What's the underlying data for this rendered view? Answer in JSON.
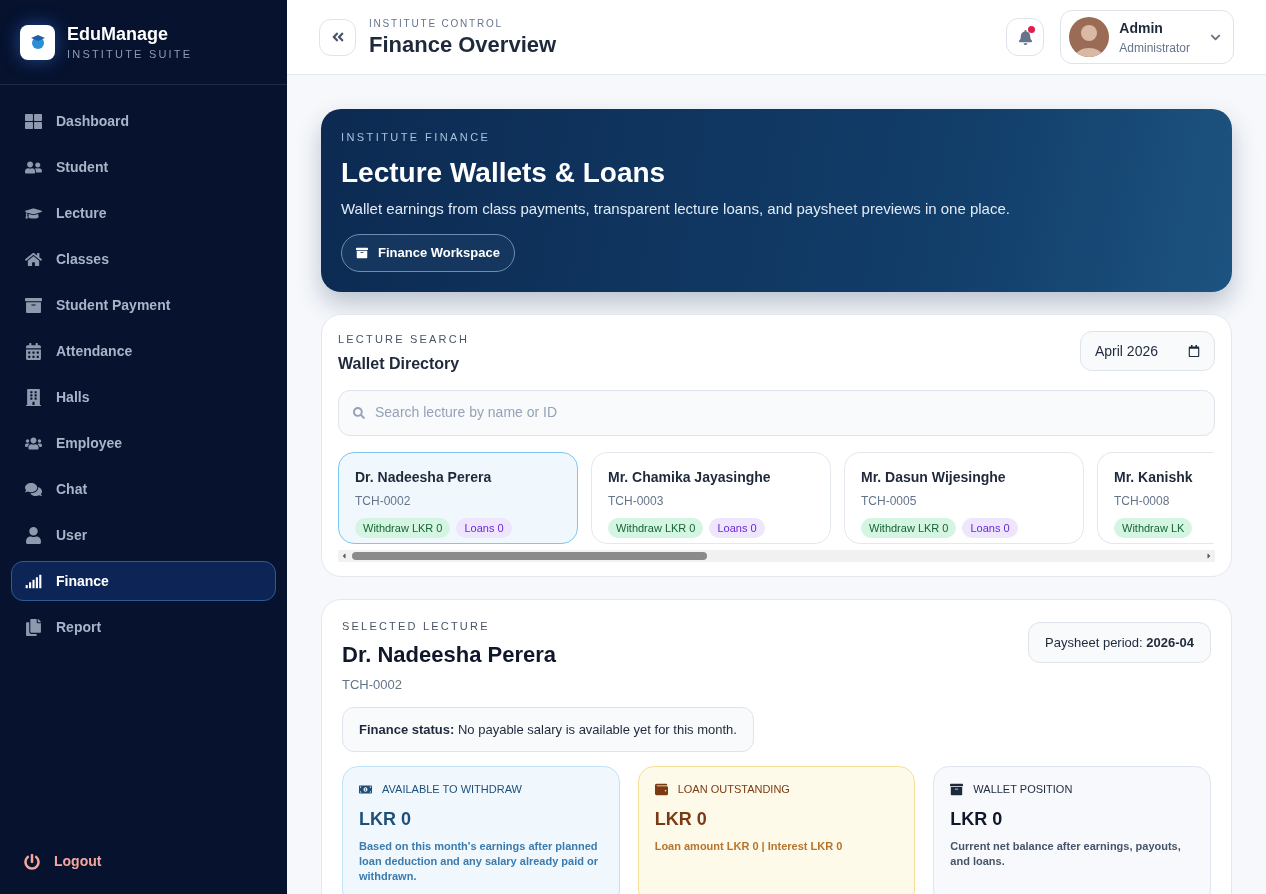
{
  "brand": {
    "name": "EduManage",
    "subtitle": "INSTITUTE SUITE"
  },
  "sidebar": {
    "items": [
      {
        "label": "Dashboard",
        "selected": false
      },
      {
        "label": "Student",
        "selected": false
      },
      {
        "label": "Lecture",
        "selected": false
      },
      {
        "label": "Classes",
        "selected": false
      },
      {
        "label": "Student Payment",
        "selected": false
      },
      {
        "label": "Attendance",
        "selected": false
      },
      {
        "label": "Halls",
        "selected": false
      },
      {
        "label": "Employee",
        "selected": false
      },
      {
        "label": "Chat",
        "selected": false
      },
      {
        "label": "User",
        "selected": false
      },
      {
        "label": "Finance",
        "selected": true
      },
      {
        "label": "Report",
        "selected": false
      }
    ],
    "logout": "Logout"
  },
  "header": {
    "eyebrow": "INSTITUTE CONTROL",
    "title": "Finance Overview",
    "notification_unread": true,
    "user": {
      "name": "Admin",
      "role": "Administrator"
    }
  },
  "hero": {
    "eyebrow": "INSTITUTE FINANCE",
    "title": "Lecture Wallets & Loans",
    "description": "Wallet earnings from class payments, transparent lecture loans, and paysheet previews in one place.",
    "button": "Finance Workspace"
  },
  "directory": {
    "eyebrow": "LECTURE SEARCH",
    "title": "Wallet Directory",
    "month": "April 2026",
    "search": {
      "placeholder": "Search lecture by name or ID"
    },
    "lectures": [
      {
        "name": "Dr. Nadeesha Perera",
        "id": "TCH-0002",
        "withdraw": "Withdraw LKR 0",
        "loans": "Loans 0",
        "selected": true
      },
      {
        "name": "Mr. Chamika Jayasinghe",
        "id": "TCH-0003",
        "withdraw": "Withdraw LKR 0",
        "loans": "Loans 0",
        "selected": false
      },
      {
        "name": "Mr. Dasun Wijesinghe",
        "id": "TCH-0005",
        "withdraw": "Withdraw LKR 0",
        "loans": "Loans 0",
        "selected": false
      },
      {
        "name": "Mr. Kanishk",
        "id": "TCH-0008",
        "withdraw": "Withdraw LK",
        "selected": false
      }
    ]
  },
  "selected_lecture": {
    "eyebrow": "SELECTED LECTURE",
    "name": "Dr. Nadeesha Perera",
    "id": "TCH-0002",
    "period": "Paysheet period: **2026-04**",
    "status": "**Finance status:** No payable salary is available yet for this month.",
    "stats": [
      {
        "kind": "withdraw",
        "label": "AVAILABLE TO WITHDRAW",
        "value": "LKR 0",
        "note": "Based on this month's earnings after planned loan deduction and any salary already paid or withdrawn."
      },
      {
        "kind": "loan",
        "label": "LOAN OUTSTANDING",
        "value": "LKR 0",
        "note": "Loan amount LKR 0 | Interest LKR 0"
      },
      {
        "kind": "wallet",
        "label": "WALLET POSITION",
        "value": "LKR 0",
        "note": "Current net balance after earnings, payouts, and loans."
      }
    ]
  }
}
